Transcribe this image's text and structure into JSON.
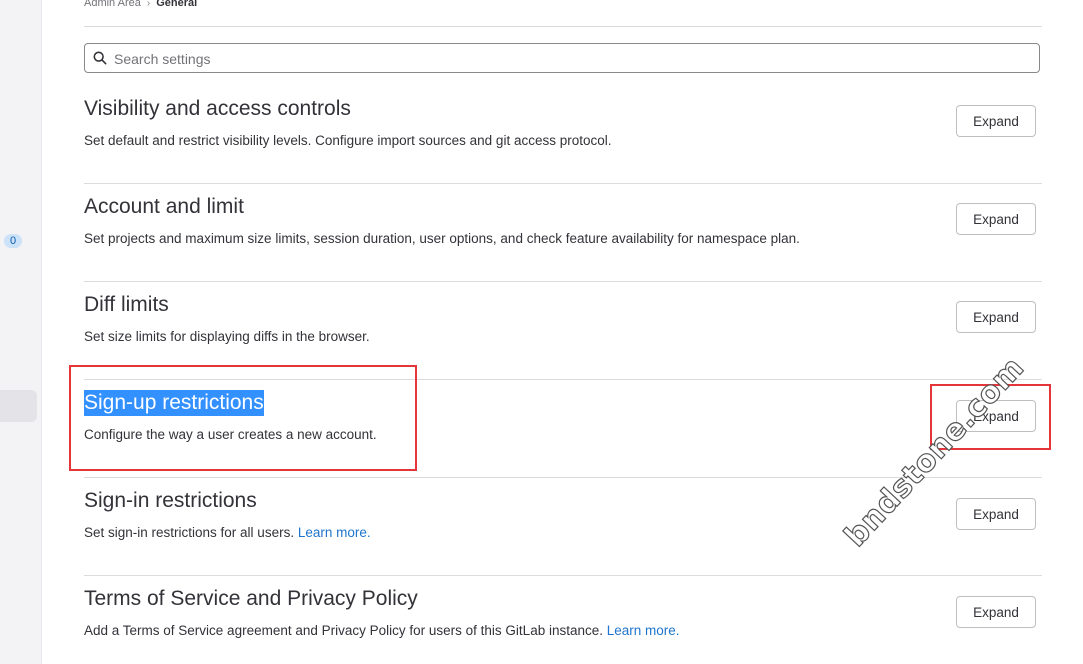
{
  "sidebar": {
    "badge_count": "0"
  },
  "breadcrumb": {
    "parent": "Admin Area",
    "separator": "›",
    "current": "General"
  },
  "search": {
    "placeholder": "Search settings",
    "value": ""
  },
  "sections": [
    {
      "title": "Visibility and access controls",
      "description": "Set default and restrict visibility levels. Configure import sources and git access protocol.",
      "link": "",
      "button": "Expand"
    },
    {
      "title": "Account and limit",
      "description": "Set projects and maximum size limits, session duration, user options, and check feature availability for namespace plan.",
      "link": "",
      "button": "Expand"
    },
    {
      "title": "Diff limits",
      "description": "Set size limits for displaying diffs in the browser.",
      "link": "",
      "button": "Expand"
    },
    {
      "title": "Sign-up restrictions",
      "description": "Configure the way a user creates a new account.",
      "link": "",
      "button": "Expand"
    },
    {
      "title": "Sign-in restrictions",
      "description": "Set sign-in restrictions for all users. ",
      "link": "Learn more.",
      "button": "Expand"
    },
    {
      "title": "Terms of Service and Privacy Policy",
      "description": "Add a Terms of Service agreement and Privacy Policy for users of this GitLab instance. ",
      "link": "Learn more.",
      "button": "Expand"
    }
  ],
  "highlight_color": "#e4363a",
  "link_color": "#1f75cb",
  "selection_color": "#3390ff",
  "watermark": "bndstone.com"
}
